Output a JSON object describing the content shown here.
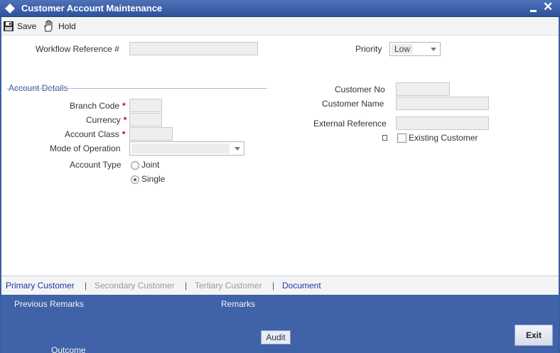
{
  "window": {
    "title": "Customer Account Maintenance",
    "minimize_icon": "minimize-icon",
    "close_label": "✕",
    "close_icon": "close-icon",
    "logo_icon": "diamond-logo-icon"
  },
  "toolbar": {
    "save_label": "Save",
    "save_icon": "floppy-disk-icon",
    "hold_label": "Hold",
    "hold_icon": "hand-hold-icon"
  },
  "form": {
    "workflow_reference_label": "Workflow Reference #",
    "workflow_reference_value": "",
    "priority_label": "Priority",
    "priority_value": "Low",
    "section_account_details": "Account Details",
    "branch_code_label": "Branch Code",
    "currency_label": "Currency",
    "account_class_label": "Account Class",
    "required_mark": "*",
    "mode_of_operation_label": "Mode of Operation",
    "mode_of_operation_value": "",
    "account_type_label": "Account Type",
    "account_type_options": [
      "Joint",
      "Single"
    ],
    "account_type_selected": "Single",
    "customer_no_label": "Customer No",
    "customer_name_label": "Customer Name",
    "external_reference_label": "External Reference",
    "existing_customer_label": "Existing Customer",
    "existing_customer_checked": false
  },
  "tabs": [
    {
      "label": "Primary Customer",
      "state": "active"
    },
    {
      "label": "Secondary Customer",
      "state": "disabled"
    },
    {
      "label": "Tertiary Customer",
      "state": "disabled"
    },
    {
      "label": "Document",
      "state": "active"
    }
  ],
  "tab_separator": "|",
  "footer": {
    "previous_remarks_label": "Previous Remarks",
    "remarks_label": "Remarks",
    "outcome_label": "Outcome",
    "audit_label": "Audit",
    "exit_label": "Exit"
  },
  "colors": {
    "title_bar": "#3a5ea6",
    "footer": "#3f62a8",
    "active_tab": "#1c36a8",
    "required": "#cc0000"
  }
}
